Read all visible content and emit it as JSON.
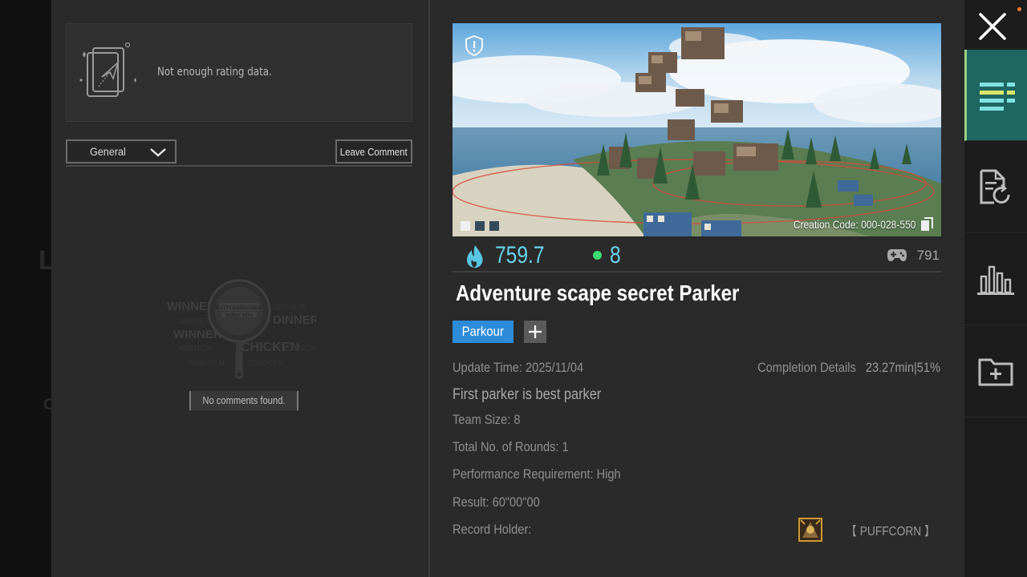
{
  "rating": {
    "text": "Not enough rating data."
  },
  "filter": {
    "selected": "General"
  },
  "comments": {
    "leave_label": "Leave Comment",
    "empty_text": "No comments found.",
    "art_words": {
      "winner": "WINNER",
      "dinner": "DINNER",
      "chicken": "CHICKEN",
      "brand_1": "BATTLEGROUNDS",
      "brand_2": "MOBILE INDIA"
    }
  },
  "map": {
    "creation_code": "Creation Code: 000-028-550",
    "heat": "759.7",
    "players": "8",
    "plays": "791",
    "title": "Adventure scape secret Parker",
    "tag": "Parkour",
    "update_time": "Update Time: 2025/11/04",
    "completion_label": "Completion Details",
    "completion_value": "23.27min|51%",
    "description": "First parker is best parker",
    "team_size": "Team Size: 8",
    "rounds": "Total No. of Rounds: 1",
    "performance": "Performance Requirement: High",
    "result": "Result: 60\"00\"00",
    "record_holder_label": "Record Holder:",
    "record_holder_name": "【 PUFFCORN 】"
  },
  "colors": {
    "accent": "#69d2e8",
    "tag_blue": "#2d8bd9",
    "online_green": "#3ddc6e",
    "sidebar_active": "#1f6561"
  },
  "icons": [
    "rating-doc-icon",
    "chevron-down-icon",
    "frying-pan-icon",
    "shield-alert-icon",
    "copy-icon",
    "flame-icon",
    "gamepad-icon",
    "plus-icon",
    "close-icon",
    "list-icon",
    "document-refresh-icon",
    "bar-chart-icon",
    "folder-add-icon"
  ]
}
